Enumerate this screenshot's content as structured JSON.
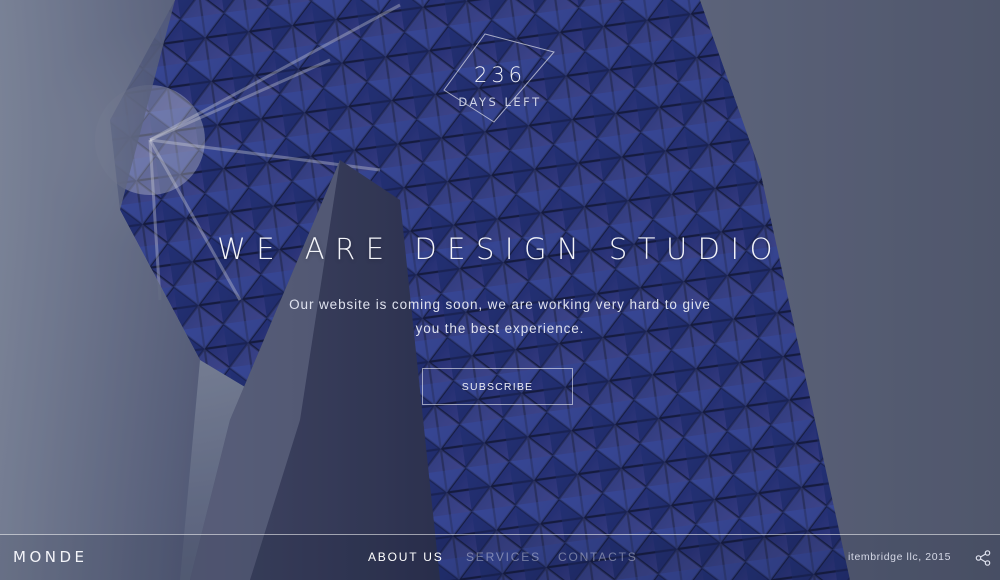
{
  "countdown": {
    "value": "236",
    "label": "DAYS LEFT"
  },
  "hero": {
    "headline": "WE ARE DESIGN STUDIO",
    "tagline": "Our website is coming soon, we are working very hard to give you the best experience.",
    "subscribe_label": "SUBSCRIBE"
  },
  "footer": {
    "logo": "MONDE",
    "nav": [
      {
        "label": "ABOUT US",
        "active": true
      },
      {
        "label": "SERVICES",
        "active": false
      },
      {
        "label": "CONTACTS",
        "active": false
      }
    ],
    "copyright": "itembridge llc, 2015",
    "share_icon": "share-icon"
  },
  "colors": {
    "background_sky": "#8a93a8",
    "building_blue": "#2b3a8a",
    "text": "#ffffff",
    "nav_inactive": "rgba(255,255,255,0.38)"
  }
}
